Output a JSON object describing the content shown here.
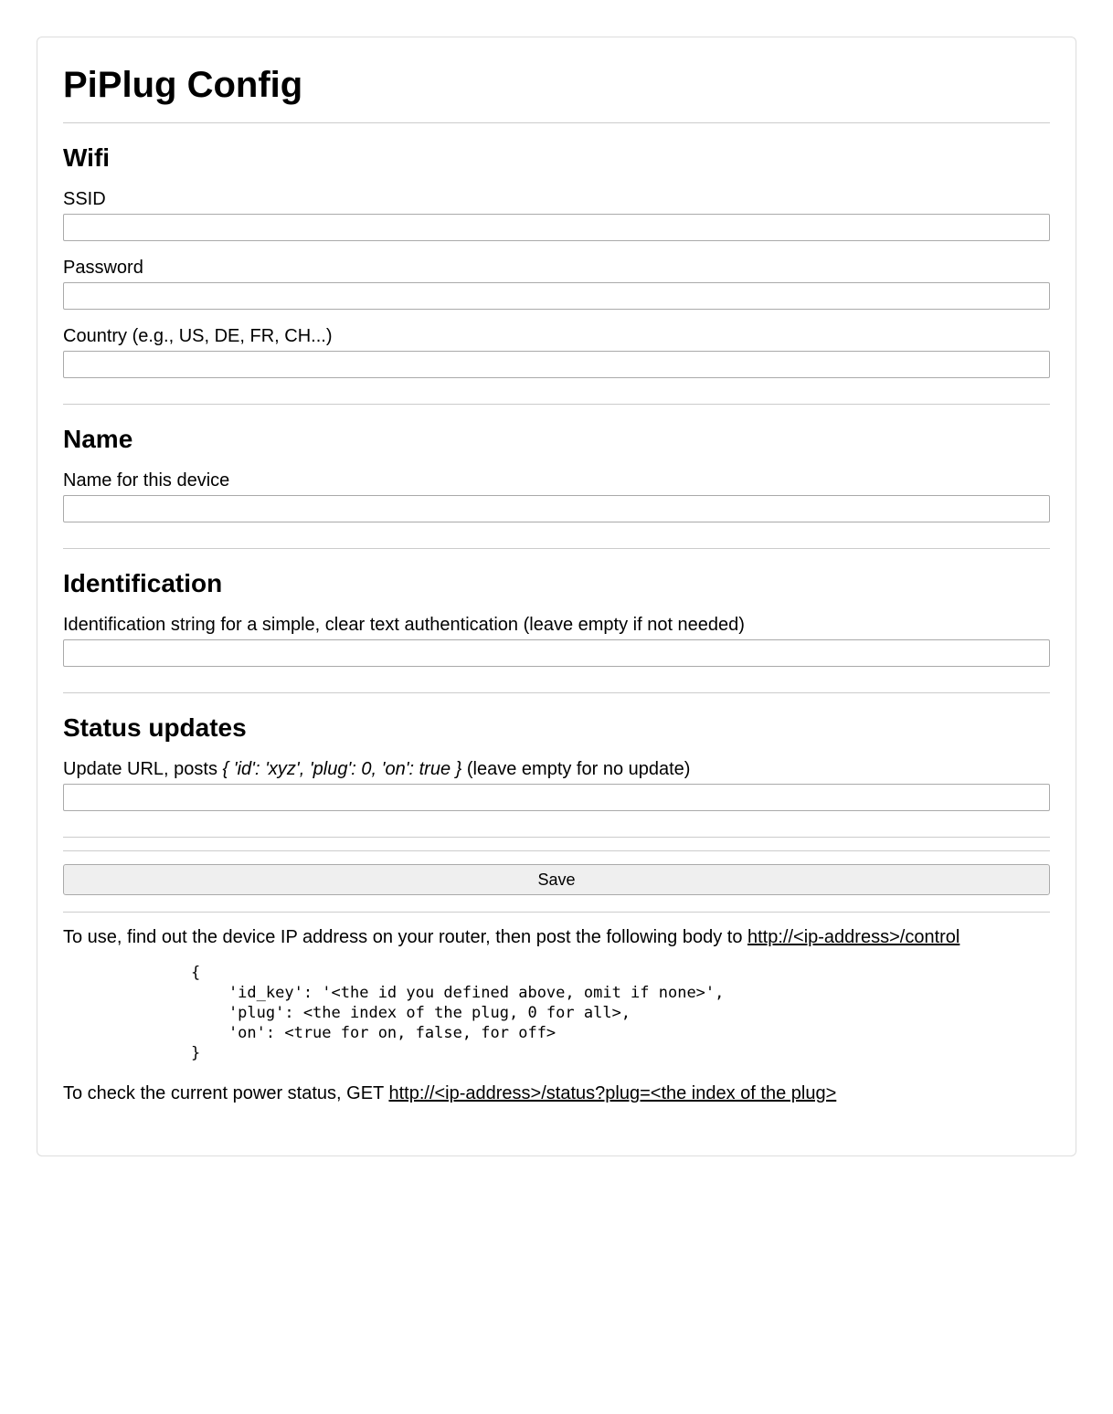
{
  "title": "PiPlug Config",
  "sections": {
    "wifi": {
      "heading": "Wifi",
      "ssid_label": "SSID",
      "ssid_value": "",
      "password_label": "Password",
      "password_value": "",
      "country_label": "Country (e.g., US, DE, FR, CH...)",
      "country_value": ""
    },
    "name": {
      "heading": "Name",
      "device_name_label": "Name for this device",
      "device_name_value": ""
    },
    "identification": {
      "heading": "Identification",
      "id_label": "Identification string for a simple, clear text authentication (leave empty if not needed)",
      "id_value": ""
    },
    "status": {
      "heading": "Status updates",
      "url_label_prefix": "Update URL, posts ",
      "url_label_code": "{ 'id': 'xyz', 'plug': 0, 'on': true }",
      "url_label_suffix": " (leave empty for no update)",
      "url_value": ""
    }
  },
  "save_button": "Save",
  "usage": {
    "line1_prefix": "To use, find out the device IP address on your router, then post the following body to ",
    "line1_link": "http://<ip-address>/control",
    "code_block": "{\n    'id_key': '<the id you defined above, omit if none>',\n    'plug': <the index of the plug, 0 for all>,\n    'on': <true for on, false, for off>\n}",
    "line2_prefix": "To check the current power status, GET ",
    "line2_link": "http://<ip-address>/status?plug=<the index of the plug>"
  }
}
